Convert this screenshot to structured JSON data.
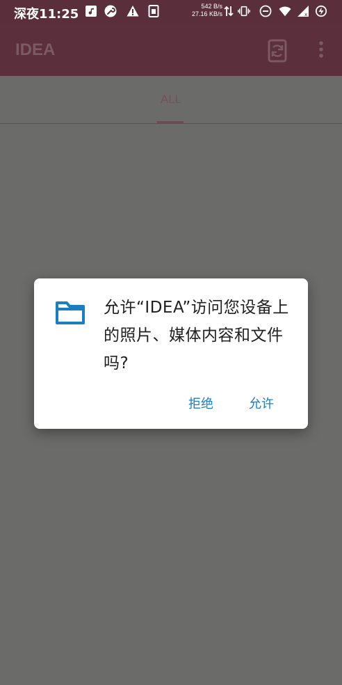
{
  "status_bar": {
    "time": "深夜11:25",
    "net_up": "542 B/s",
    "net_down": "27.16 KB/s",
    "icons": [
      "music-icon",
      "wrench-icon",
      "warning-icon",
      "sim-card-icon",
      "data-arrows-icon",
      "vibrate-icon",
      "dnd-icon",
      "wifi-icon",
      "signal-icon",
      "battery-saver-icon"
    ]
  },
  "app_bar": {
    "title": "IDEA",
    "icons": [
      "sync-icon",
      "more-vert-icon"
    ]
  },
  "tabs": [
    {
      "label": "ALL",
      "selected": true
    }
  ],
  "dialog": {
    "icon": "folder-icon",
    "message": "允许“IDEA”访问您设备上的照片、媒体内容和文件吗?",
    "deny_label": "拒绝",
    "allow_label": "允许"
  },
  "colors": {
    "app_bar": "#5b2f3b",
    "scrim": "#6b6c6a",
    "accent": "#1a7fc1",
    "dialog_bg": "#ffffff"
  }
}
